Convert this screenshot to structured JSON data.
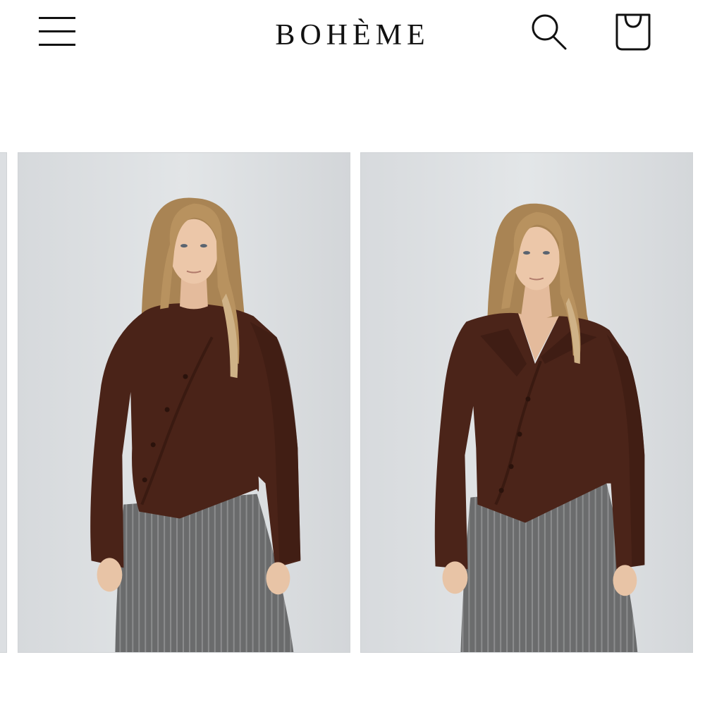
{
  "header": {
    "brand": "BOHÈME",
    "menu_icon": "hamburger-menu-icon",
    "search_icon": "search-icon",
    "bag_icon": "shopping-bag-icon"
  },
  "gallery": {
    "images": [
      {
        "icon": "product-photo",
        "style": "crew-neck asymmetric cardigan, brown"
      },
      {
        "icon": "product-photo",
        "style": "open collar asymmetric cardigan, brown"
      }
    ]
  },
  "colors": {
    "background": "#ffffff",
    "text": "#111111",
    "photo_backdrop": "#dcdfe2",
    "sweater": "#4a2318",
    "skirt": "#6b6c6d",
    "hair": "#b08a5a"
  }
}
